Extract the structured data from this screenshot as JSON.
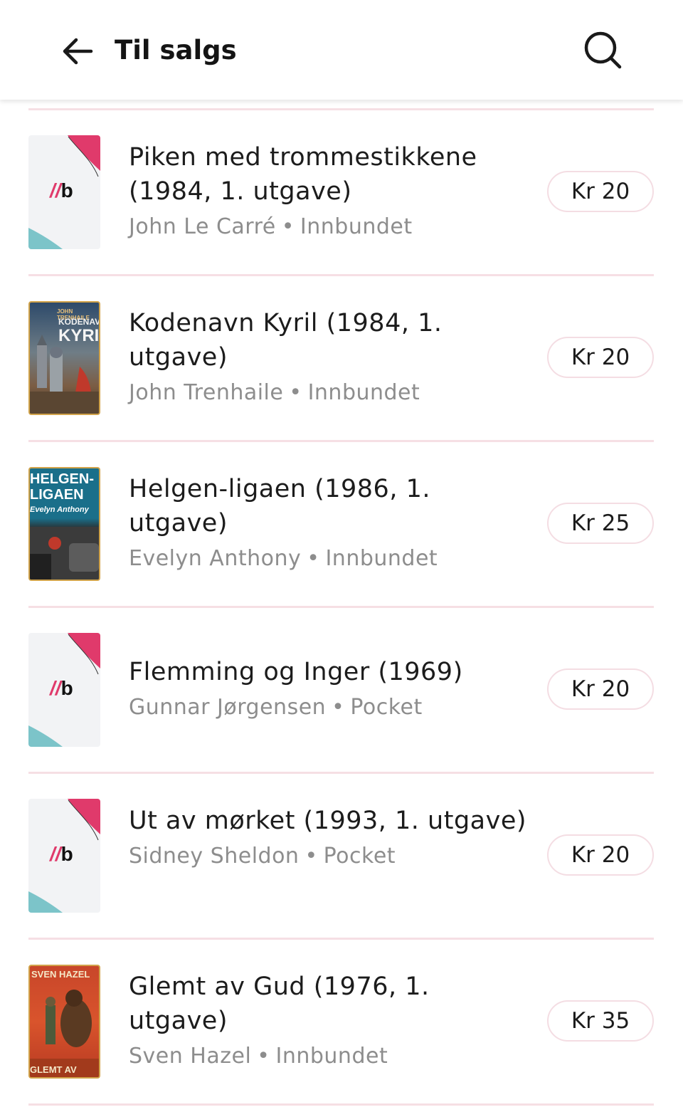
{
  "header": {
    "title": "Til salgs",
    "back_icon": "arrow-left-icon",
    "search_icon": "search-icon"
  },
  "items": [
    {
      "title": "Piken med trommestikkene (1984, 1. utgave)",
      "author": "John Le Carré",
      "format": "Innbundet",
      "price": "Kr 20",
      "cover": "placeholder"
    },
    {
      "title": "Kodenavn Kyril (1984, 1. utgave)",
      "author": "John Trenhaile",
      "format": "Innbundet",
      "price": "Kr 20",
      "cover": "photo",
      "cover_text": {
        "top": "JOHN TRENHAILE",
        "line1": "KODENAVN",
        "line2": "KYRIL"
      }
    },
    {
      "title": "Helgen-ligaen (1986, 1. utgave)",
      "author": "Evelyn Anthony",
      "format": "Innbundet",
      "price": "Kr 25",
      "cover": "photo",
      "cover_text": {
        "line1": "HELGEN-",
        "line2": "LIGAEN",
        "line3": "Evelyn Anthony"
      }
    },
    {
      "title": "Flemming og Inger (1969)",
      "author": "Gunnar Jørgensen",
      "format": "Pocket",
      "price": "Kr 20",
      "cover": "placeholder"
    },
    {
      "title": "Ut av mørket (1993, 1. utgave)",
      "author": "Sidney Sheldon",
      "format": "Pocket",
      "price": "Kr 20",
      "cover": "placeholder"
    },
    {
      "title": "Glemt av Gud (1976, 1. utgave)",
      "author": "Sven Hazel",
      "format": "Innbundet",
      "price": "Kr 35",
      "cover": "photo",
      "cover_text": {
        "line1": "SVEN HAZEL",
        "line2": "GLEMT AV GUD"
      }
    }
  ],
  "placeholder_logo": {
    "slash": "//",
    "letter": "b"
  },
  "colors": {
    "accent": "#e03a6b",
    "divider": "#f6dfe4",
    "secondary_text": "#8d8d8d",
    "teal": "#7cc4c9"
  }
}
